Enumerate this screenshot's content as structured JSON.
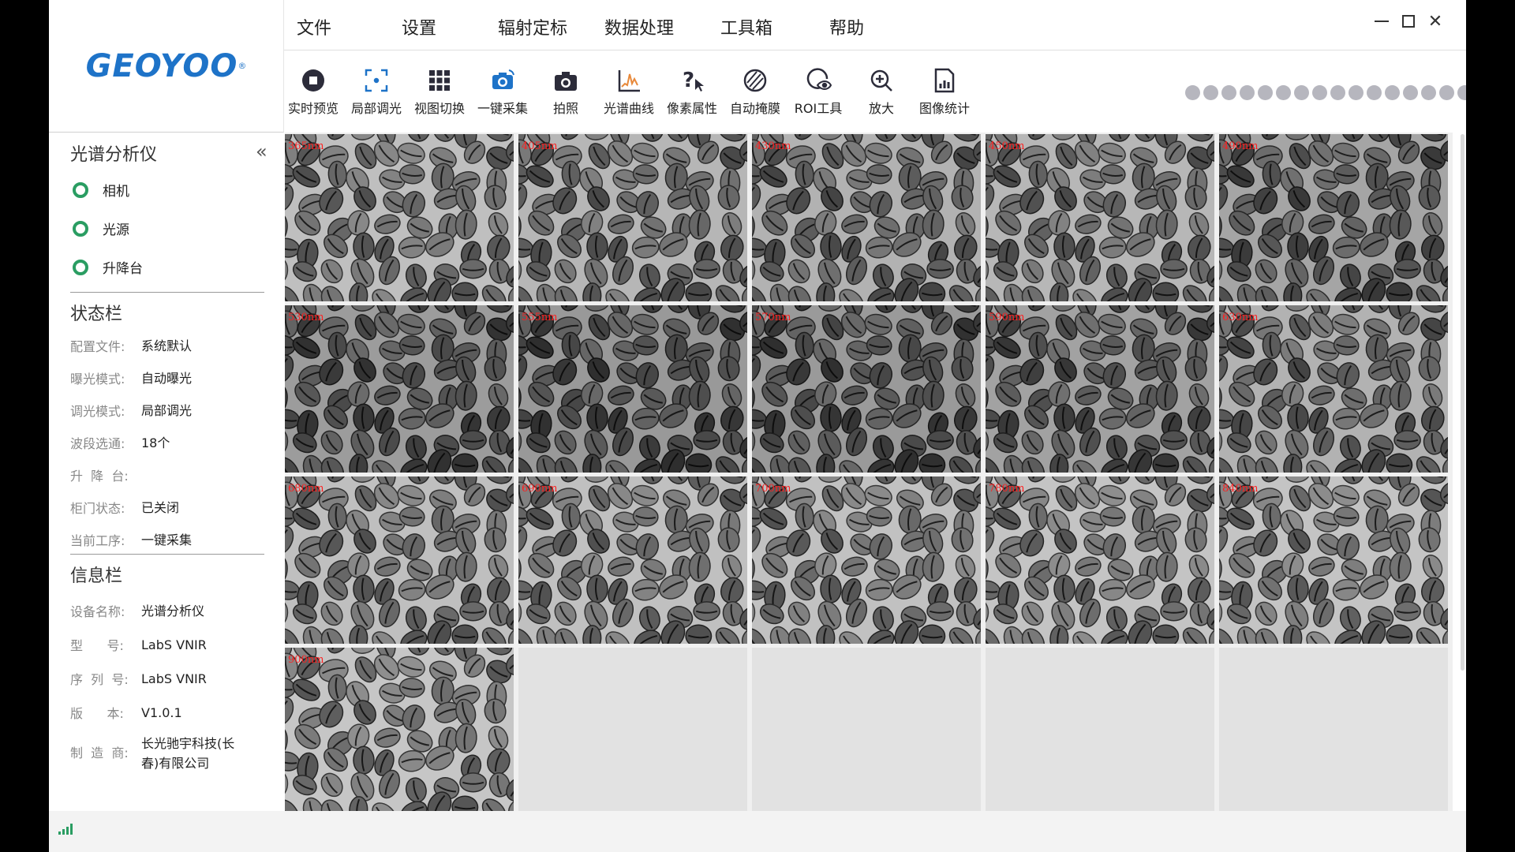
{
  "logo": {
    "text": "GEOYOO",
    "reg": "®"
  },
  "menu": [
    "文件",
    "设置",
    "辐射定标",
    "数据处理",
    "工具箱",
    "帮助"
  ],
  "toolbar": [
    {
      "label": "实时预览",
      "icon": "stop-circle-icon"
    },
    {
      "label": "局部调光",
      "icon": "focus-frame-icon"
    },
    {
      "label": "视图切换",
      "icon": "grid-view-icon"
    },
    {
      "label": "一键采集",
      "icon": "camera-sync-icon"
    },
    {
      "label": "拍照",
      "icon": "camera-icon"
    },
    {
      "label": "光谱曲线",
      "icon": "spectrum-chart-icon"
    },
    {
      "label": "像素属性",
      "icon": "pixel-query-icon"
    },
    {
      "label": "自动掩膜",
      "icon": "mask-icon"
    },
    {
      "label": "ROI工具",
      "icon": "roi-eye-icon"
    },
    {
      "label": "放大",
      "icon": "zoom-in-icon"
    },
    {
      "label": "图像统计",
      "icon": "statistics-icon"
    }
  ],
  "band_dots": {
    "count": 18,
    "active_index": 16,
    "active_color": "#8a2a7c",
    "inactive_color": "#b6b6be"
  },
  "spectrometer": {
    "title": "光谱分析仪",
    "devices": [
      "相机",
      "光源",
      "升降台"
    ]
  },
  "status": {
    "title": "状态栏",
    "items": [
      {
        "key": "配置文件:",
        "value": "系统默认"
      },
      {
        "key": "曝光模式:",
        "value": "自动曝光"
      },
      {
        "key": "调光模式:",
        "value": "局部调光"
      },
      {
        "key": "波段选通:",
        "value": "18个"
      },
      {
        "key": "升  降  台:",
        "value": ""
      },
      {
        "key": "柜门状态:",
        "value": "已关闭"
      },
      {
        "key": "当前工序:",
        "value": "一键采集"
      }
    ]
  },
  "info": {
    "title": "信息栏",
    "items": [
      {
        "key": "设备名称:",
        "value": "光谱分析仪"
      },
      {
        "key": "型      号:",
        "value": "LabS VNIR"
      },
      {
        "key": "序  列  号:",
        "value": "LabS VNIR"
      },
      {
        "key": "版      本:",
        "value": "V1.0.1"
      },
      {
        "key": "制  造  商:",
        "value": "长光驰宇科技(长春)有限公司"
      }
    ]
  },
  "bands": [
    {
      "label": "365nm",
      "brightness": 0.62
    },
    {
      "label": "405nm",
      "brightness": 0.55
    },
    {
      "label": "430nm",
      "brightness": 0.52
    },
    {
      "label": "450nm",
      "brightness": 0.56
    },
    {
      "label": "490nm",
      "brightness": 0.42
    },
    {
      "label": "530nm",
      "brightness": 0.35
    },
    {
      "label": "555nm",
      "brightness": 0.33
    },
    {
      "label": "570nm",
      "brightness": 0.34
    },
    {
      "label": "590nm",
      "brightness": 0.4
    },
    {
      "label": "630nm",
      "brightness": 0.52
    },
    {
      "label": "680nm",
      "brightness": 0.62
    },
    {
      "label": "690nm",
      "brightness": 0.63
    },
    {
      "label": "700nm",
      "brightness": 0.64
    },
    {
      "label": "780nm",
      "brightness": 0.66
    },
    {
      "label": "840nm",
      "brightness": 0.66
    },
    {
      "label": "900nm",
      "brightness": 0.68
    }
  ],
  "empty_cells": 4,
  "accent": "#2a9d62"
}
